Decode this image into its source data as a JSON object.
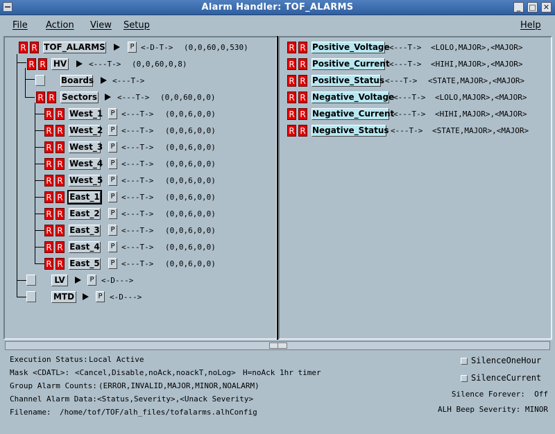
{
  "window": {
    "title": "Alarm Handler: TOF_ALARMS",
    "minimize": "_",
    "maximize": "□",
    "close": "✕"
  },
  "menu": {
    "file": "File",
    "action": "Action",
    "view": "View",
    "setup": "Setup",
    "help": "Help"
  },
  "tree": {
    "root": {
      "r1": "R",
      "r2": "R",
      "name": "TOF_ALARMS",
      "p": "P",
      "mask": "<-D-T->",
      "counts": "(0,0,60,0,530)"
    },
    "hv": {
      "r1": "R",
      "r2": "R",
      "name": "HV",
      "mask": "<---T->",
      "counts": "(0,0,60,0,8)"
    },
    "boards": {
      "name": "Boards",
      "mask": "<---T->"
    },
    "sectors": {
      "r1": "R",
      "r2": "R",
      "name": "Sectors",
      "mask": "<---T->",
      "counts": "(0,0,60,0,0)"
    },
    "items": [
      {
        "r1": "R",
        "r2": "R",
        "name": "West_1",
        "p": "P",
        "mask": "<---T->",
        "counts": "(0,0,6,0,0)"
      },
      {
        "r1": "R",
        "r2": "R",
        "name": "West_2",
        "p": "P",
        "mask": "<---T->",
        "counts": "(0,0,6,0,0)"
      },
      {
        "r1": "R",
        "r2": "R",
        "name": "West_3",
        "p": "P",
        "mask": "<---T->",
        "counts": "(0,0,6,0,0)"
      },
      {
        "r1": "R",
        "r2": "R",
        "name": "West_4",
        "p": "P",
        "mask": "<---T->",
        "counts": "(0,0,6,0,0)"
      },
      {
        "r1": "R",
        "r2": "R",
        "name": "West_5",
        "p": "P",
        "mask": "<---T->",
        "counts": "(0,0,6,0,0)"
      },
      {
        "r1": "R",
        "r2": "R",
        "name": "East_1",
        "p": "P",
        "mask": "<---T->",
        "counts": "(0,0,6,0,0)"
      },
      {
        "r1": "R",
        "r2": "R",
        "name": "East_2",
        "p": "P",
        "mask": "<---T->",
        "counts": "(0,0,6,0,0)"
      },
      {
        "r1": "R",
        "r2": "R",
        "name": "East_3",
        "p": "P",
        "mask": "<---T->",
        "counts": "(0,0,6,0,0)"
      },
      {
        "r1": "R",
        "r2": "R",
        "name": "East_4",
        "p": "P",
        "mask": "<---T->",
        "counts": "(0,0,6,0,0)"
      },
      {
        "r1": "R",
        "r2": "R",
        "name": "East_5",
        "p": "P",
        "mask": "<---T->",
        "counts": "(0,0,6,0,0)"
      }
    ],
    "selected": "East_1",
    "lv": {
      "name": "LV",
      "p": "P",
      "mask": "<-D--->"
    },
    "mtd": {
      "name": "MTD",
      "p": "P",
      "mask": "<-D--->"
    }
  },
  "channels": [
    {
      "r1": "R",
      "r2": "R",
      "name": "Positive_Voltage",
      "mask": "<---T->",
      "data": "<LOLO,MAJOR>,<MAJOR>"
    },
    {
      "r1": "R",
      "r2": "R",
      "name": "Positive_Current",
      "mask": "<---T->",
      "data": "<HIHI,MAJOR>,<MAJOR>"
    },
    {
      "r1": "R",
      "r2": "R",
      "name": "Positive_Status",
      "mask": "<---T->",
      "data": "<STATE,MAJOR>,<MAJOR>"
    },
    {
      "r1": "R",
      "r2": "R",
      "name": "Negative_Voltage",
      "mask": "<---T->",
      "data": "<LOLO,MAJOR>,<MAJOR>"
    },
    {
      "r1": "R",
      "r2": "R",
      "name": "Negative_Current",
      "mask": "<---T->",
      "data": "<HIHI,MAJOR>,<MAJOR>"
    },
    {
      "r1": "R",
      "r2": "R",
      "name": "Negative_Status",
      "mask": "<---T->",
      "data": "<STATE,MAJOR>,<MAJOR>"
    }
  ],
  "status": {
    "exec_label": "Execution Status:",
    "exec_value": "Local Active",
    "mask_label": "Mask <CDATL>:",
    "mask_value": "<Cancel,Disable,noAck,noackT,noLog>",
    "mask_extra": "H=noAck 1hr timer",
    "group_label": "Group Alarm Counts:",
    "group_value": "(ERROR,INVALID,MAJOR,MINOR,NOALARM)",
    "channel_label": "Channel Alarm Data:",
    "channel_value": "<Status,Severity>,<Unack Severity>",
    "file_label": "Filename:",
    "file_value": "/home/tof/TOF/alh_files/tofalarms.alhConfig",
    "silence_hour": "SilenceOneHour",
    "silence_current": "SilenceCurrent",
    "silence_forever": "Silence Forever:  Off",
    "beep": "ALH Beep Severity: MINOR"
  }
}
